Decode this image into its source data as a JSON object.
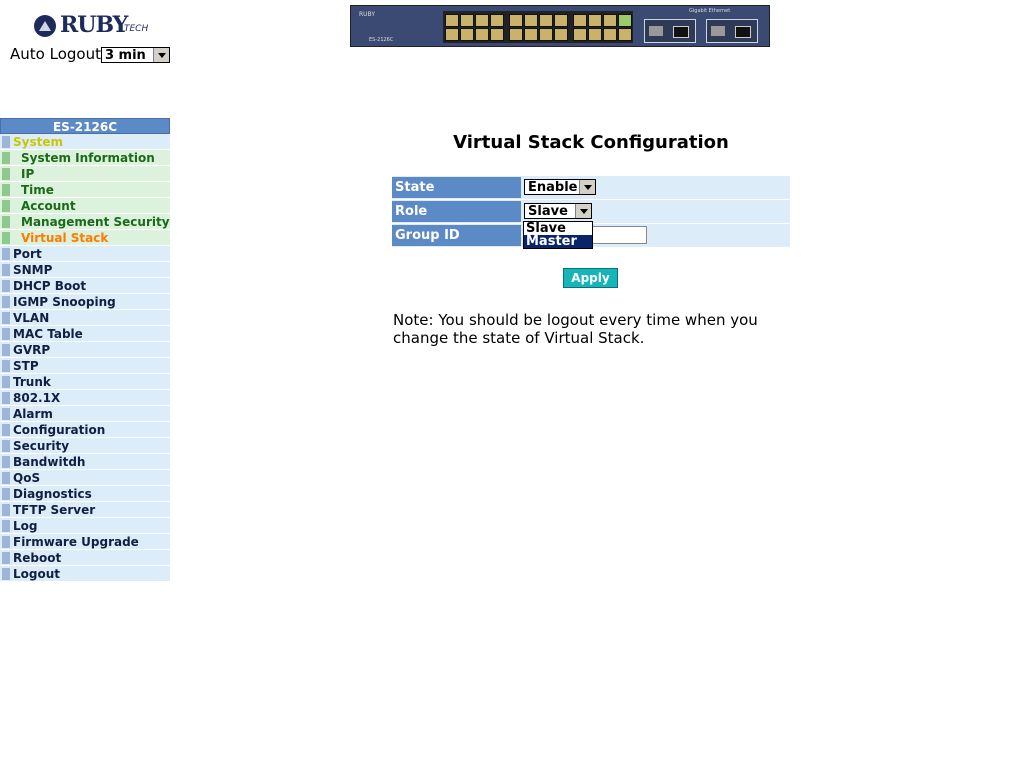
{
  "brand": {
    "logo_text": "RUBY",
    "logo_sub": "TECH"
  },
  "header": {
    "auto_logout_label": "Auto Logout",
    "auto_logout_value": "3 min"
  },
  "device": {
    "brand": "RUBY",
    "model": "ES-2126C",
    "ge_label": "Gigabit Ethernet"
  },
  "sidebar": {
    "title": "ES-2126C",
    "items": [
      {
        "label": "System",
        "style": "yellow"
      },
      {
        "label": "System Information",
        "style": "sub"
      },
      {
        "label": "IP",
        "style": "sub"
      },
      {
        "label": "Time",
        "style": "sub"
      },
      {
        "label": "Account",
        "style": "sub"
      },
      {
        "label": "Management Security",
        "style": "sub"
      },
      {
        "label": "Virtual Stack",
        "style": "sub active"
      },
      {
        "label": "Port",
        "style": ""
      },
      {
        "label": "SNMP",
        "style": ""
      },
      {
        "label": "DHCP Boot",
        "style": ""
      },
      {
        "label": "IGMP Snooping",
        "style": ""
      },
      {
        "label": "VLAN",
        "style": ""
      },
      {
        "label": "MAC Table",
        "style": ""
      },
      {
        "label": "GVRP",
        "style": ""
      },
      {
        "label": "STP",
        "style": ""
      },
      {
        "label": "Trunk",
        "style": ""
      },
      {
        "label": "802.1X",
        "style": ""
      },
      {
        "label": "Alarm",
        "style": ""
      },
      {
        "label": "Configuration",
        "style": ""
      },
      {
        "label": "Security",
        "style": ""
      },
      {
        "label": "Bandwitdh",
        "style": ""
      },
      {
        "label": "QoS",
        "style": ""
      },
      {
        "label": "Diagnostics",
        "style": ""
      },
      {
        "label": "TFTP Server",
        "style": ""
      },
      {
        "label": "Log",
        "style": ""
      },
      {
        "label": "Firmware Upgrade",
        "style": ""
      },
      {
        "label": "Reboot",
        "style": ""
      },
      {
        "label": "Logout",
        "style": ""
      }
    ]
  },
  "main": {
    "title": "Virtual Stack Configuration",
    "state_label": "State",
    "state_value": "Enable",
    "role_label": "Role",
    "role_value": "Slave",
    "role_options": [
      "Slave",
      "Master"
    ],
    "role_highlighted": "Master",
    "group_id_label": "Group ID",
    "group_id_value": "",
    "apply_label": "Apply",
    "note": "Note: You should be logout every time when you change the state of Virtual Stack."
  },
  "colors": {
    "header_blue": "#5b8ac7",
    "row_light_blue": "#dcecf8",
    "apply_teal": "#16b5ba",
    "active_orange": "#ff7a00"
  }
}
